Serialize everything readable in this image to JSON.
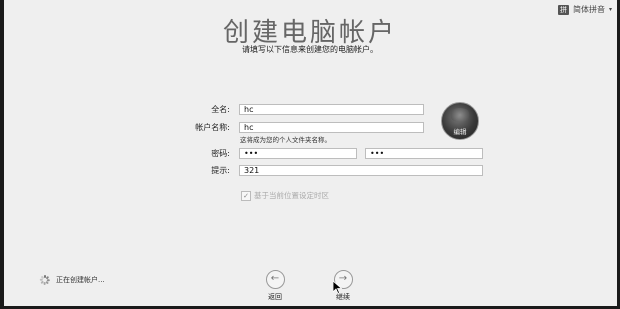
{
  "input_menu": {
    "badge": "拼",
    "label": "简体拼音",
    "chevron": "▾"
  },
  "page": {
    "title": "创建电脑帐户",
    "subtitle": "请填写以下信息来创建您的电脑帐户。"
  },
  "form": {
    "full_name": {
      "label": "全名:",
      "value": "hc"
    },
    "account_name": {
      "label": "帐户名称:",
      "value": "hc",
      "hint": "这将成为您的个人文件夹名称。"
    },
    "password": {
      "label": "密码:",
      "value": "•••",
      "verify_value": "•••"
    },
    "hint": {
      "label": "提示:",
      "value": "321"
    },
    "timezone": {
      "label": "基于当前位置设定时区",
      "checked": true,
      "check_glyph": "✓"
    }
  },
  "avatar": {
    "edit_label": "编辑"
  },
  "status": {
    "text": "正在创建帐户..."
  },
  "nav": {
    "back": {
      "label": "返回",
      "icon": "←"
    },
    "continue": {
      "label": "继续",
      "icon": "→"
    }
  }
}
